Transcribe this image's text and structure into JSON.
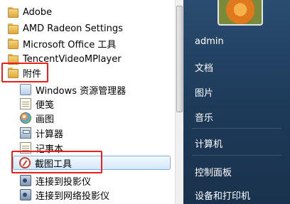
{
  "programs": {
    "folders": [
      {
        "label": "Adobe"
      },
      {
        "label": "AMD Radeon Settings"
      },
      {
        "label": "Microsoft Office 工具"
      },
      {
        "label": "TencentVideoMPlayer"
      },
      {
        "label": "附件"
      }
    ],
    "accessories": [
      {
        "label": "Windows 资源管理器"
      },
      {
        "label": "便笺"
      },
      {
        "label": "画图"
      },
      {
        "label": "计算器"
      },
      {
        "label": "记事本"
      },
      {
        "label": "截图工具"
      },
      {
        "label": "连接到投影仪"
      },
      {
        "label": "连接到网络投影仪"
      }
    ]
  },
  "right_menu": {
    "user": "admin",
    "items": [
      "文档",
      "图片",
      "音乐",
      "计算机",
      "控制面板",
      "设备和打印机"
    ]
  },
  "colors": {
    "highlight_box": "#e8221b",
    "selected_bg": "#d5e8fb",
    "right_pane": "#1e3b5a"
  }
}
